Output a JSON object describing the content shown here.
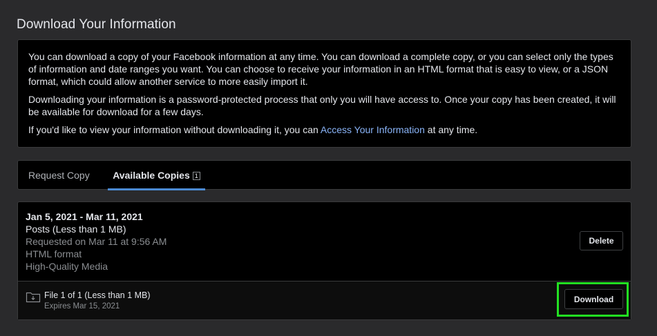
{
  "page": {
    "title": "Download Your Information"
  },
  "info": {
    "paragraph1": "You can download a copy of your Facebook information at any time. You can download a complete copy, or you can select only the types of information and date ranges you want. You can choose to receive your information in an HTML format that is easy to view, or a JSON format, which could allow another service to more easily import it.",
    "paragraph2": "Downloading your information is a password-protected process that only you will have access to. Once your copy has been created, it will be available for download for a few days.",
    "paragraph3_prefix": "If you'd like to view your information without downloading it, you can ",
    "paragraph3_link": "Access Your Information",
    "paragraph3_suffix": " at any time."
  },
  "tabs": [
    {
      "label": "Request Copy",
      "active": false
    },
    {
      "label": "Available Copies",
      "active": true,
      "badge": "1"
    }
  ],
  "copy": {
    "date_range": "Jan 5, 2021 - Mar 11, 2021",
    "content": "Posts (Less than 1 MB)",
    "requested": "Requested on Mar 11 at 9:56 AM",
    "format": "HTML format",
    "media_quality": "High-Quality Media",
    "delete_label": "Delete",
    "file": {
      "title": "File 1 of 1 (Less than 1 MB)",
      "expires": "Expires Mar 15, 2021",
      "icon": "folder-download-icon",
      "download_label": "Download"
    }
  },
  "colors": {
    "background": "#2a2a2c",
    "panel": "#000000",
    "link": "#8ab4f8",
    "tab_underline": "#4b8bd4",
    "highlight": "#22e022"
  }
}
